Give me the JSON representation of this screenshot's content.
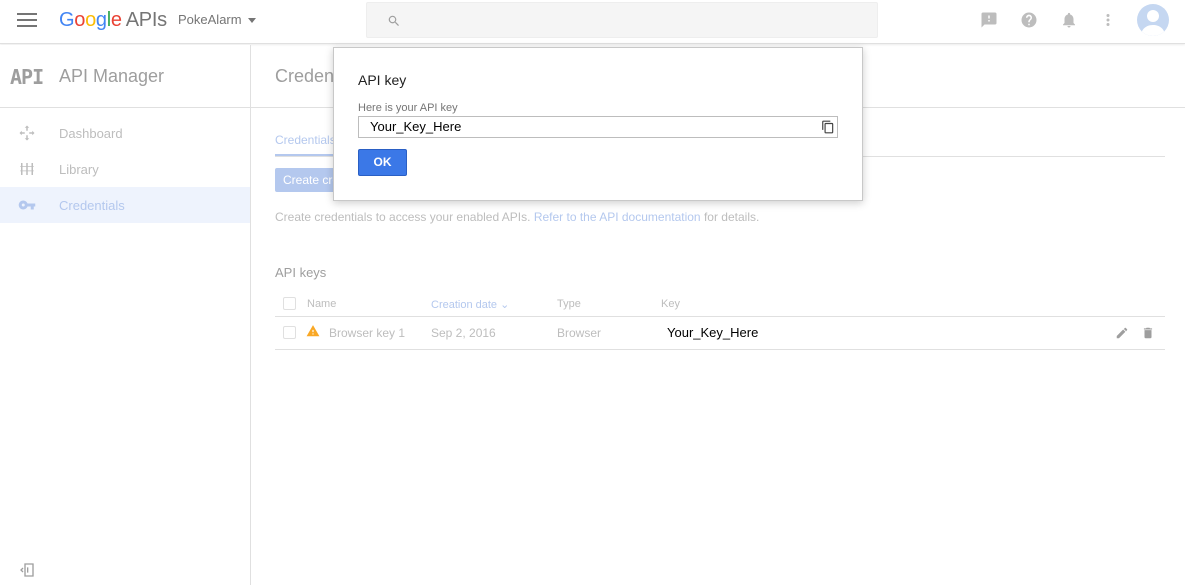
{
  "topbar": {
    "logo_letters": [
      "G",
      "o",
      "o",
      "g",
      "l",
      "e"
    ],
    "logo_suffix": "APIs",
    "project_name": "PokeAlarm",
    "icons": [
      "menu-icon",
      "search-icon",
      "feedback-icon",
      "help-icon",
      "notifications-icon",
      "more-vert-icon",
      "account-avatar"
    ]
  },
  "sidebar": {
    "logo_text": "API",
    "title": "API Manager",
    "items": [
      {
        "label": "Dashboard",
        "icon": "dashboard-icon",
        "active": false
      },
      {
        "label": "Library",
        "icon": "library-icon",
        "active": false
      },
      {
        "label": "Credentials",
        "icon": "key-icon",
        "active": true
      }
    ]
  },
  "main": {
    "title": "Credentials",
    "tab_label": "Credentials",
    "create_button": "Create credentials",
    "info_prefix": "Create credentials to access your enabled APIs.",
    "info_link": "Refer to the API documentation",
    "info_suffix": "for details.",
    "section_title": "API keys",
    "table": {
      "columns": [
        "Name",
        "Creation date",
        "Type",
        "Key"
      ],
      "sorted_column": "Creation date",
      "rows": [
        {
          "name": "Browser key 1",
          "date": "Sep 2, 2016",
          "type": "Browser",
          "key": "Your_Key_Here"
        }
      ]
    }
  },
  "modal": {
    "title": "API key",
    "label": "Here is your API key",
    "key_value": "Your_Key_Here",
    "ok_label": "OK"
  },
  "colors": {
    "accent": "#3b78e7",
    "faded_accent": "#b4c8ee",
    "warning": "#f9a825"
  }
}
